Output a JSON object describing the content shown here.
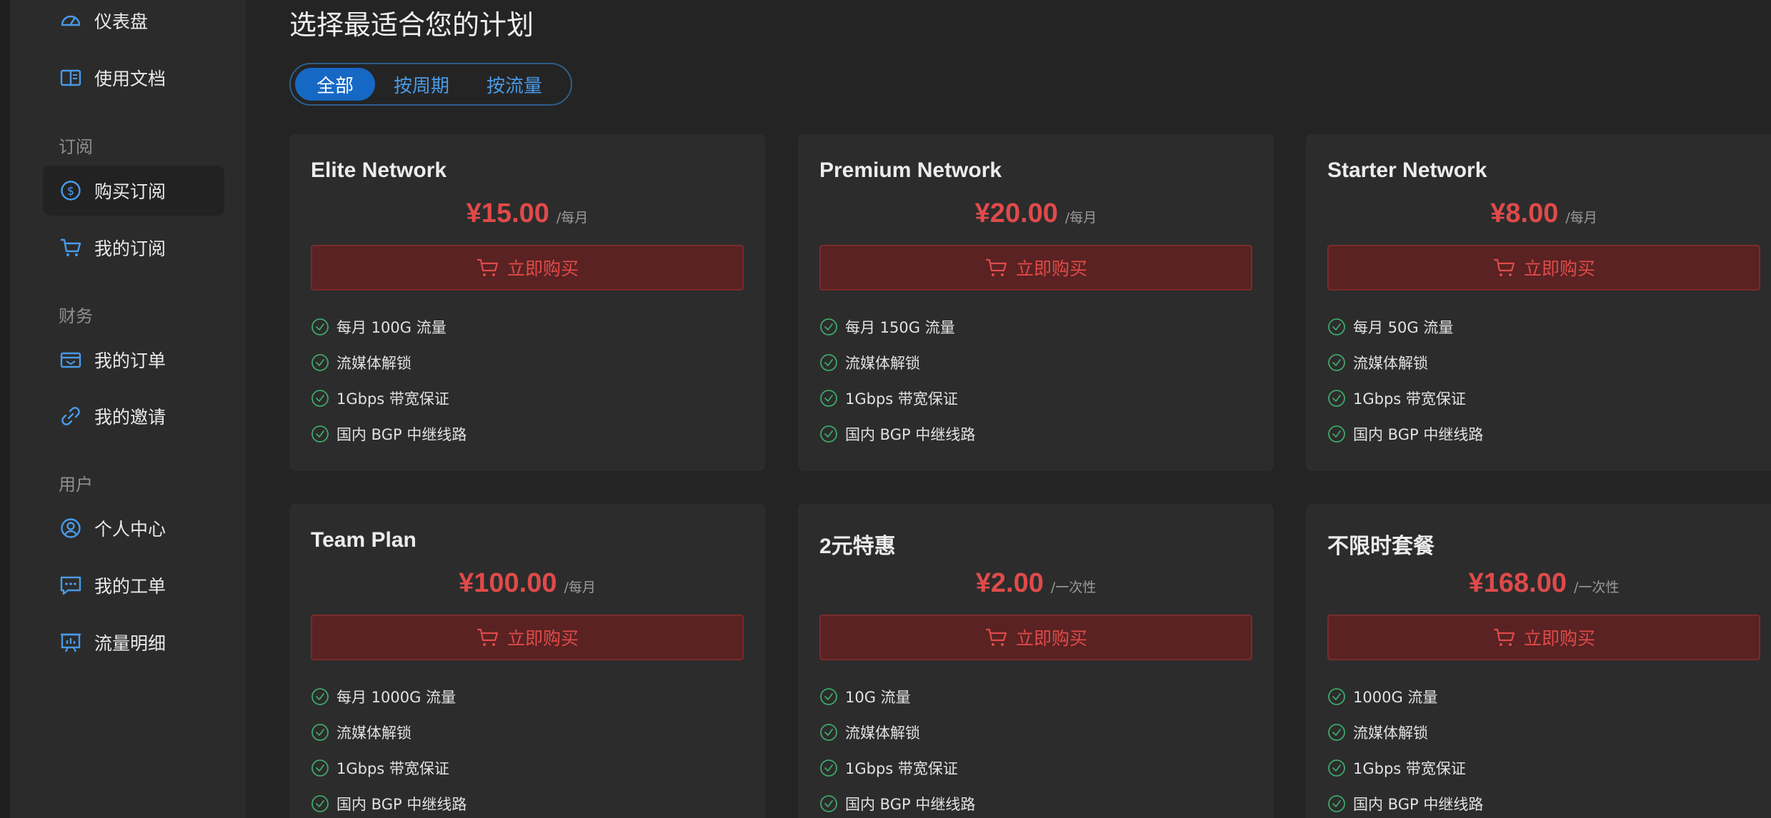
{
  "sidebar": {
    "items": [
      {
        "label": "仪表盘"
      },
      {
        "label": "使用文档"
      },
      {
        "label": "购买订阅"
      },
      {
        "label": "我的订阅"
      },
      {
        "label": "我的订单"
      },
      {
        "label": "我的邀请"
      },
      {
        "label": "个人中心"
      },
      {
        "label": "我的工单"
      },
      {
        "label": "流量明细"
      }
    ],
    "sections": {
      "subscribe": "订阅",
      "finance": "财务",
      "user": "用户"
    }
  },
  "main": {
    "title": "选择最适合您的计划",
    "tabs": [
      "全部",
      "按周期",
      "按流量"
    ],
    "buy_label": "立即购买",
    "plans": [
      {
        "name": "Elite Network",
        "price": "¥15.00",
        "period": "/每月",
        "features": [
          "每月 100G 流量",
          "流媒体解锁",
          "1Gbps 带宽保证",
          "国内 BGP 中继线路"
        ]
      },
      {
        "name": "Premium Network",
        "price": "¥20.00",
        "period": "/每月",
        "features": [
          "每月 150G 流量",
          "流媒体解锁",
          "1Gbps 带宽保证",
          "国内 BGP 中继线路"
        ]
      },
      {
        "name": "Starter Network",
        "price": "¥8.00",
        "period": "/每月",
        "features": [
          "每月 50G 流量",
          "流媒体解锁",
          "1Gbps 带宽保证",
          "国内 BGP 中继线路"
        ]
      },
      {
        "name": "Team Plan",
        "price": "¥100.00",
        "period": "/每月",
        "features": [
          "每月 1000G 流量",
          "流媒体解锁",
          "1Gbps 带宽保证",
          "国内 BGP 中继线路"
        ]
      },
      {
        "name": "2元特惠",
        "price": "¥2.00",
        "period": "/一次性",
        "features": [
          "10G 流量",
          "流媒体解锁",
          "1Gbps 带宽保证",
          "国内 BGP 中继线路"
        ]
      },
      {
        "name": "不限时套餐",
        "price": "¥168.00",
        "period": "/一次性",
        "features": [
          "1000G 流量",
          "流媒体解锁",
          "1Gbps 带宽保证",
          "国内 BGP 中继线路"
        ]
      }
    ]
  },
  "colors": {
    "accent": "#1668c5",
    "price": "#e04a4a",
    "check": "#3fa86a",
    "icon": "#4a9ae8"
  }
}
